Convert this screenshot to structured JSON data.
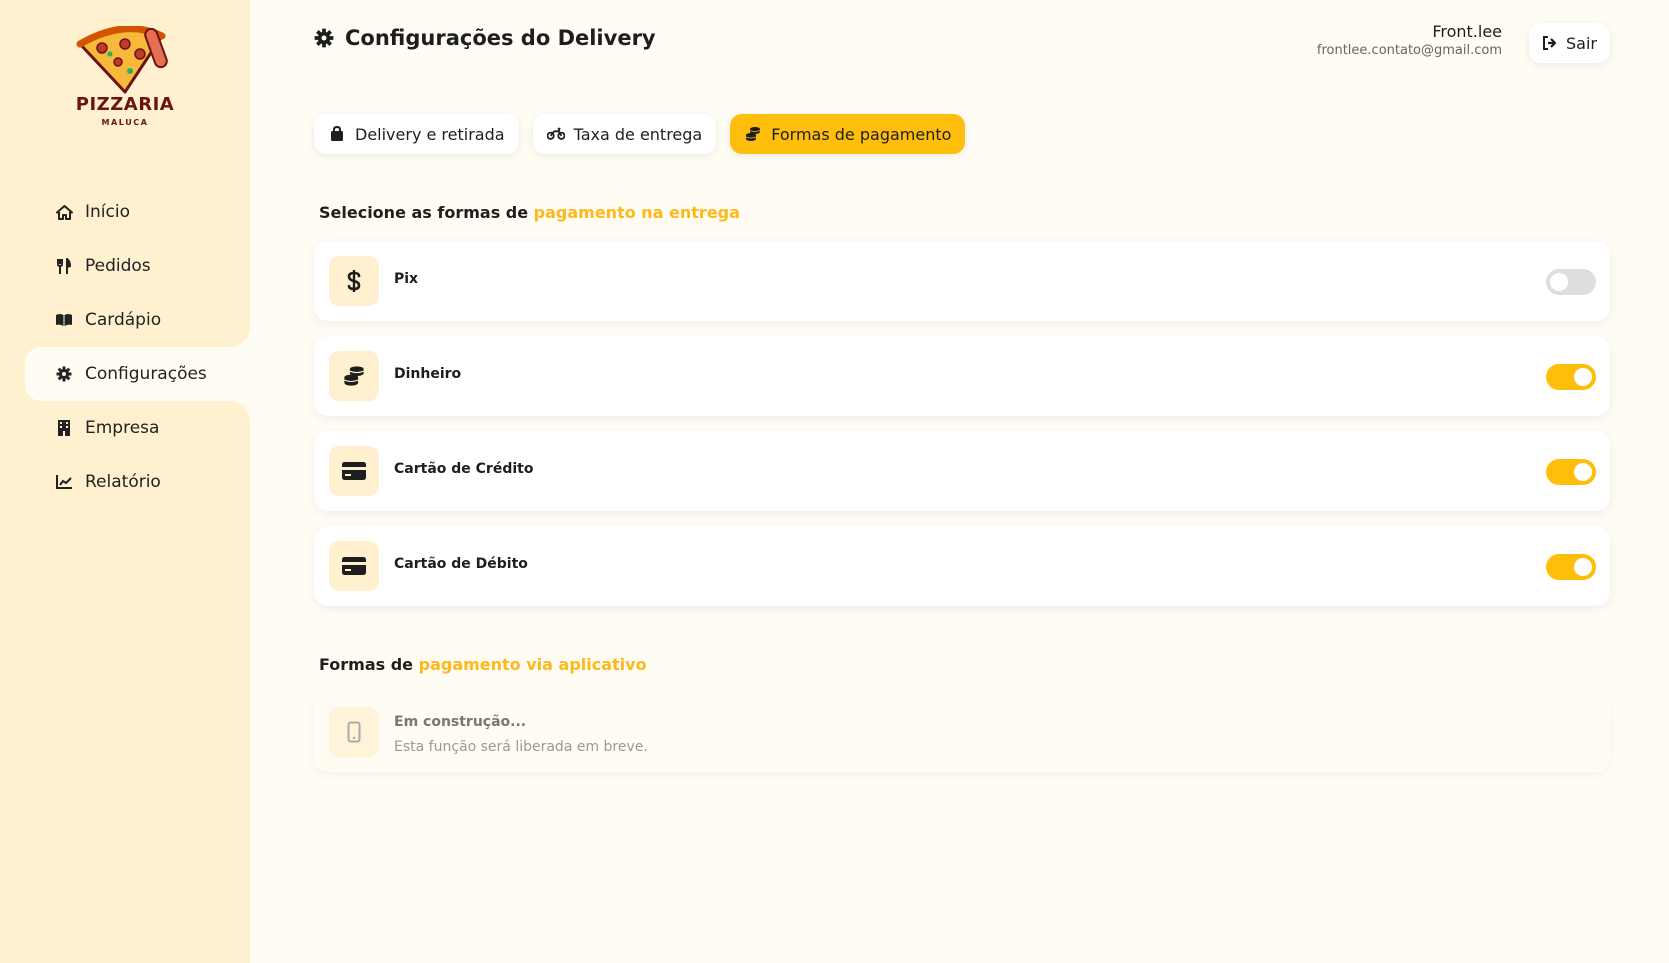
{
  "brand": {
    "name": "PIZZARIA",
    "tagline": "MALUCA"
  },
  "sidebar": {
    "items": [
      {
        "label": "Início",
        "icon": "home-icon"
      },
      {
        "label": "Pedidos",
        "icon": "utensils-icon"
      },
      {
        "label": "Cardápio",
        "icon": "book-icon"
      },
      {
        "label": "Configurações",
        "icon": "gear-icon",
        "active": true
      },
      {
        "label": "Empresa",
        "icon": "building-icon"
      },
      {
        "label": "Relatório",
        "icon": "chart-line-icon"
      }
    ]
  },
  "header": {
    "title": "Configurações do Delivery",
    "user_name": "Front.lee",
    "user_email": "frontlee.contato@gmail.com",
    "logout_label": "Sair"
  },
  "tabs": [
    {
      "label": "Delivery e retirada",
      "icon": "bag-icon"
    },
    {
      "label": "Taxa de entrega",
      "icon": "motorcycle-icon"
    },
    {
      "label": "Formas de pagamento",
      "icon": "coins-icon",
      "active": true
    }
  ],
  "delivery_payments": {
    "label_prefix": "Selecione as formas de ",
    "label_highlight": "pagamento na entrega",
    "methods": [
      {
        "label": "Pix",
        "icon": "dollar-icon",
        "enabled": false
      },
      {
        "label": "Dinheiro",
        "icon": "coins-icon",
        "enabled": true
      },
      {
        "label": "Cartão de Crédito",
        "icon": "credit-card-icon",
        "enabled": true
      },
      {
        "label": "Cartão de Débito",
        "icon": "credit-card-icon",
        "enabled": true
      }
    ]
  },
  "app_payments": {
    "label_prefix": "Formas de ",
    "label_highlight": "pagamento via aplicativo",
    "status_title": "Em construção...",
    "status_desc": "Esta função será liberada em breve."
  },
  "colors": {
    "accent": "#ffbe0b",
    "accent_text": "#ffb81c",
    "sidebar_bg": "#fff1cf",
    "page_bg": "#fffcf3"
  }
}
